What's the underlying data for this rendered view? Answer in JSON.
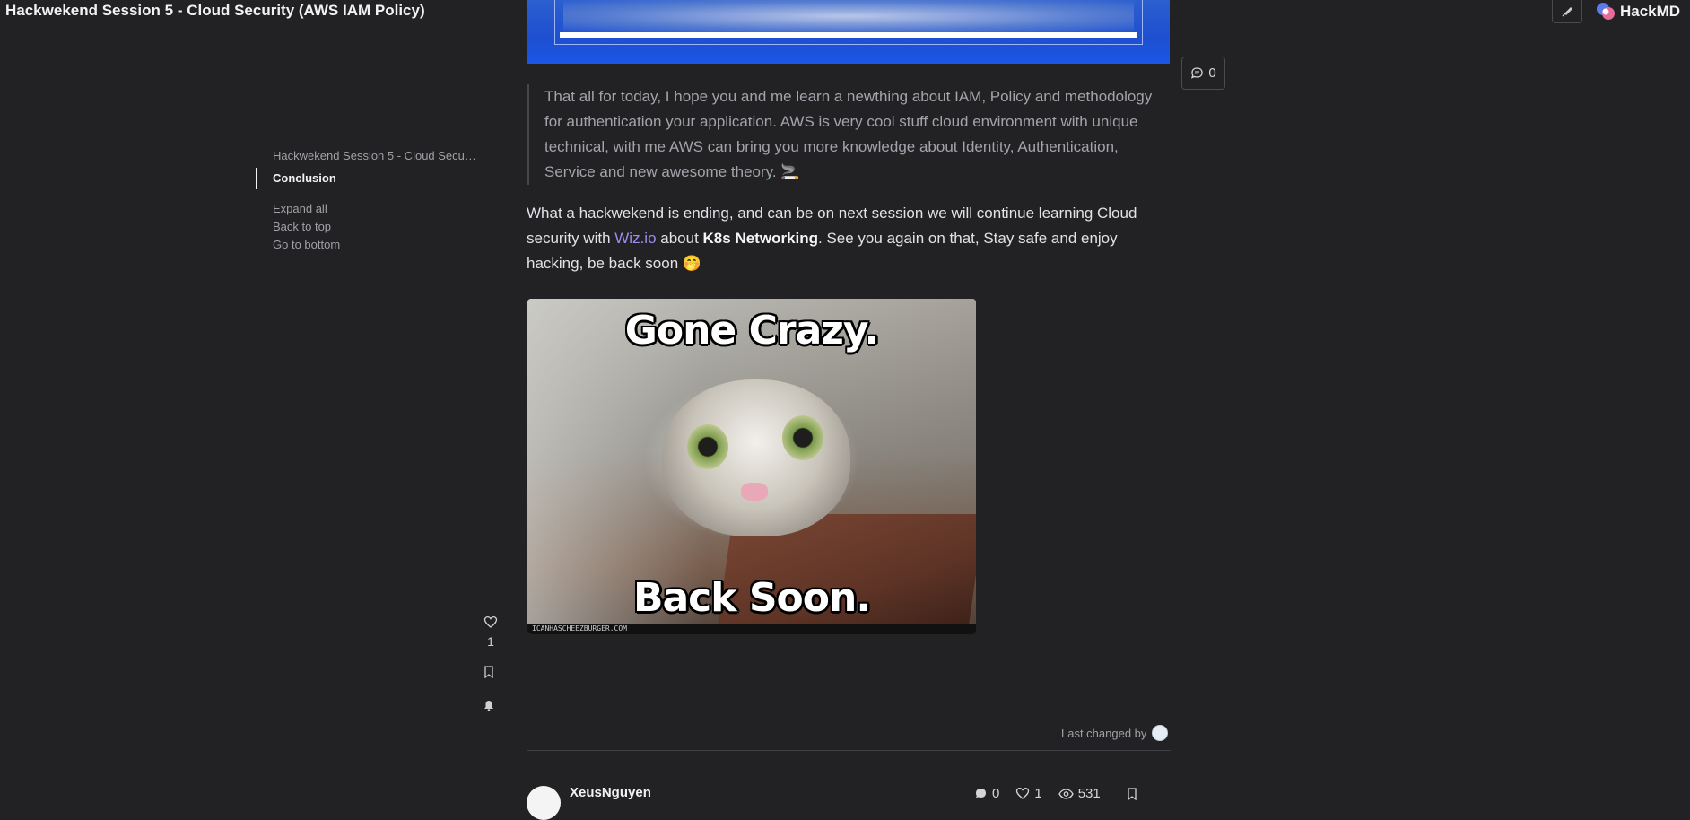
{
  "header": {
    "title": "Hackwekend Session 5 - Cloud Security (AWS IAM Policy)",
    "brand": "HackMD"
  },
  "comments": {
    "count": "0"
  },
  "toc": {
    "items": [
      "Hackwekend Session 5 - Cloud Security (AWS IAM Policy)",
      "Conclusion"
    ],
    "links": [
      "Expand all",
      "Back to top",
      "Go to bottom"
    ]
  },
  "content": {
    "quote": "That all for today, I hope you and me learn a newthing about IAM, Policy and methodology for authentication your application. AWS is very cool stuff cloud environment with unique technical, with me AWS can bring you more knowledge about Identity, Authentication, Service and new awesome theory. 🚬",
    "para_prefix": "What a hackwekend is ending, and can be on next session we will continue learning Cloud security with ",
    "para_link": "Wiz.io",
    "para_mid": " about ",
    "para_bold": "K8s Networking",
    "para_suffix": ". See you again on that, Stay safe and enjoy hacking, be back soon 🤭",
    "meme_top": "Gone Crazy.",
    "meme_bottom": "Back Soon.",
    "meme_footer": "ICANHASCHEEZBURGER.COM"
  },
  "reactions": {
    "likes": "1"
  },
  "footer": {
    "last_changed_label": "Last changed by",
    "author": "XeusNguyen",
    "comments": "0",
    "likes": "1",
    "views": "531"
  },
  "colors": {
    "background": "#222225",
    "link": "#9b8cf0",
    "banner": "#1e4fd0"
  }
}
